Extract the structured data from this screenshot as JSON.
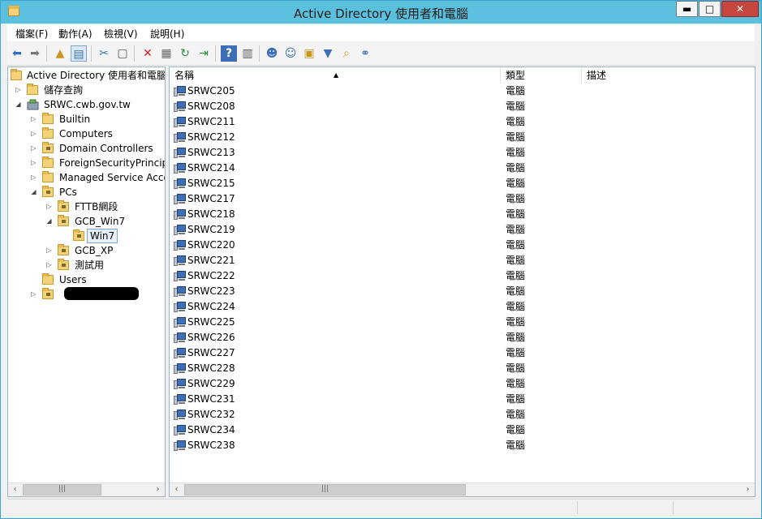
{
  "window": {
    "title": "Active Directory 使用者和電腦",
    "minimize": "▬",
    "maximize": "□",
    "close": "✕"
  },
  "menu": [
    {
      "label": "檔案(F)"
    },
    {
      "label": "動作(A)"
    },
    {
      "label": "檢視(V)"
    },
    {
      "label": "說明(H)"
    }
  ],
  "tree": {
    "root": "Active Directory 使用者和電腦 [",
    "saved_queries": "儲存查詢",
    "domain": "SRWC.cwb.gov.tw",
    "containers": {
      "builtin": "Builtin",
      "computers": "Computers",
      "domain_controllers": "Domain Controllers",
      "foreign": "ForeignSecurityPrincipa",
      "managed": "Managed Service Acco",
      "pcs": "PCs",
      "fttb": "FTTB網段",
      "gcb_win7": "GCB_Win7",
      "win7": "Win7",
      "gcb_xp": "GCB_XP",
      "test": "測試用",
      "users": "Users"
    }
  },
  "columns": {
    "name": "名稱",
    "type": "類型",
    "desc": "描述"
  },
  "computers": [
    {
      "name": "SRWC205",
      "type": "電腦"
    },
    {
      "name": "SRWC208",
      "type": "電腦"
    },
    {
      "name": "SRWC211",
      "type": "電腦"
    },
    {
      "name": "SRWC212",
      "type": "電腦"
    },
    {
      "name": "SRWC213",
      "type": "電腦"
    },
    {
      "name": "SRWC214",
      "type": "電腦"
    },
    {
      "name": "SRWC215",
      "type": "電腦"
    },
    {
      "name": "SRWC217",
      "type": "電腦"
    },
    {
      "name": "SRWC218",
      "type": "電腦"
    },
    {
      "name": "SRWC219",
      "type": "電腦"
    },
    {
      "name": "SRWC220",
      "type": "電腦"
    },
    {
      "name": "SRWC221",
      "type": "電腦"
    },
    {
      "name": "SRWC222",
      "type": "電腦"
    },
    {
      "name": "SRWC223",
      "type": "電腦"
    },
    {
      "name": "SRWC224",
      "type": "電腦"
    },
    {
      "name": "SRWC225",
      "type": "電腦"
    },
    {
      "name": "SRWC226",
      "type": "電腦"
    },
    {
      "name": "SRWC227",
      "type": "電腦"
    },
    {
      "name": "SRWC228",
      "type": "電腦"
    },
    {
      "name": "SRWC229",
      "type": "電腦"
    },
    {
      "name": "SRWC231",
      "type": "電腦"
    },
    {
      "name": "SRWC232",
      "type": "電腦"
    },
    {
      "name": "SRWC234",
      "type": "電腦"
    },
    {
      "name": "SRWC238",
      "type": "電腦"
    }
  ],
  "colors": {
    "titlebar": "#5bc0de",
    "close": "#c7463f",
    "selection": "#e5f0fb"
  }
}
